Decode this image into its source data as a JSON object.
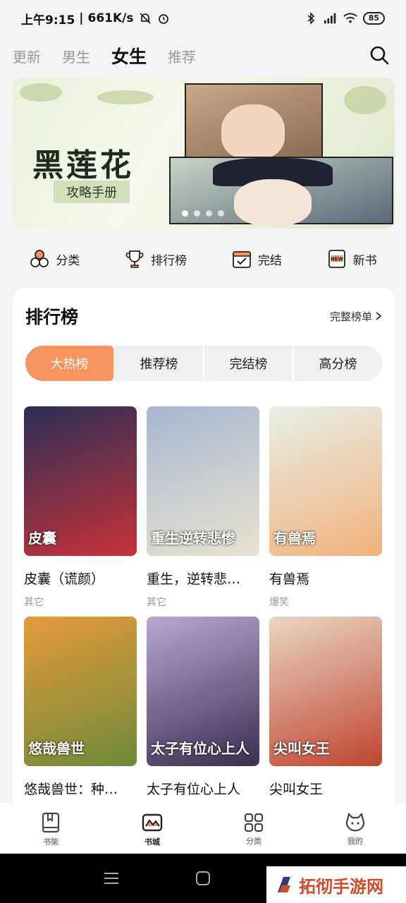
{
  "status_bar": {
    "time": "上午9:15",
    "speed": "661K/s",
    "battery": "85"
  },
  "top_tabs": [
    {
      "label": "更新",
      "active": false
    },
    {
      "label": "男生",
      "active": false
    },
    {
      "label": "女生",
      "active": true
    },
    {
      "label": "推荐",
      "active": false
    }
  ],
  "banner": {
    "title": "黑莲花",
    "subtitle": "攻略手册",
    "slide_count": 4,
    "active_slide": 1
  },
  "quick_nav": [
    {
      "label": "分类",
      "icon": "category-icon"
    },
    {
      "label": "排行榜",
      "icon": "trophy-icon"
    },
    {
      "label": "完结",
      "icon": "calendar-check-icon"
    },
    {
      "label": "新书",
      "icon": "new-book-icon"
    }
  ],
  "ranking": {
    "title": "排行榜",
    "more_label": "完整榜单",
    "tabs": [
      "大热榜",
      "推荐榜",
      "完结榜",
      "高分榜"
    ],
    "active_tab": 0,
    "books": [
      {
        "title": "皮囊（谎颜）",
        "tag": "其它",
        "cover_text": "皮囊",
        "colors": [
          "#2a2f55",
          "#c8323a"
        ]
      },
      {
        "title": "重生，逆转悲…",
        "tag": "其它",
        "cover_text": "重生逆转悲惨",
        "colors": [
          "#a7b7d1",
          "#e9e2cf"
        ]
      },
      {
        "title": "有兽焉",
        "tag": "爆笑",
        "cover_text": "有兽焉",
        "colors": [
          "#e7efe9",
          "#f1b27a"
        ]
      },
      {
        "title": "悠哉兽世：种…",
        "tag": "",
        "cover_text": "悠哉兽世",
        "colors": [
          "#e79a3a",
          "#6d8a3a"
        ]
      },
      {
        "title": "太子有位心上人",
        "tag": "",
        "cover_text": "太子有位心上人",
        "colors": [
          "#b9a6d6",
          "#3a2f4f"
        ]
      },
      {
        "title": "尖叫女王",
        "tag": "",
        "cover_text": "尖叫女王",
        "colors": [
          "#e9d6c4",
          "#c0452e"
        ]
      }
    ]
  },
  "bottom_nav": [
    {
      "label": "书架",
      "icon": "bookshelf-icon",
      "active": false
    },
    {
      "label": "书城",
      "icon": "bookstore-icon",
      "active": true
    },
    {
      "label": "分类",
      "icon": "grid-icon",
      "active": false
    },
    {
      "label": "我的",
      "icon": "profile-icon",
      "active": false
    }
  ],
  "watermark": {
    "text": "拓彻手游网"
  },
  "colors": {
    "accent": "#f6935f",
    "background": "#f3f3f3",
    "card": "#ffffff"
  }
}
